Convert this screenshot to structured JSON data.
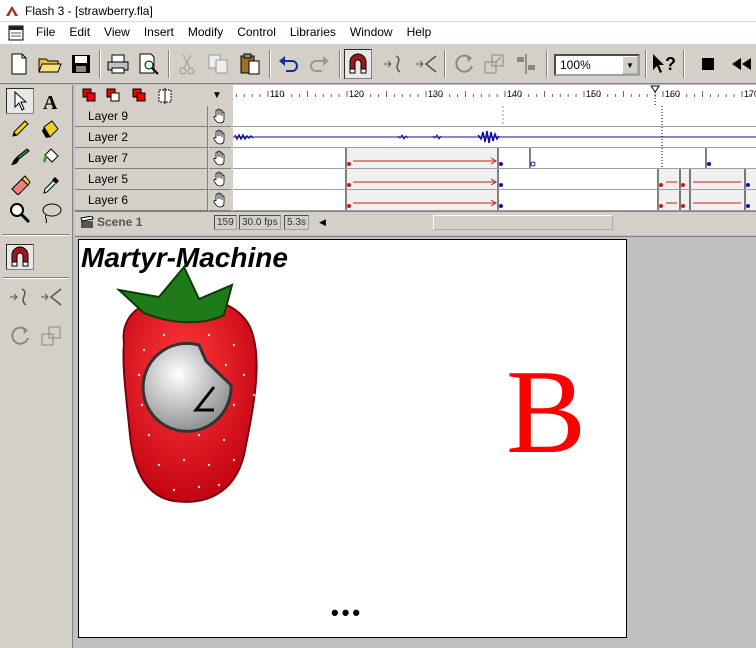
{
  "window": {
    "title": "Flash 3 - [strawberry.fla]"
  },
  "menu": [
    "File",
    "Edit",
    "View",
    "Insert",
    "Modify",
    "Control",
    "Libraries",
    "Window",
    "Help"
  ],
  "toolbar": {
    "zoom": "100%",
    "buttons": [
      "new-file",
      "open",
      "save",
      "print",
      "print-preview",
      "cut",
      "copy",
      "paste",
      "undo",
      "redo",
      "snap",
      "smooth",
      "straighten",
      "rotate",
      "scale",
      "align",
      "help",
      "stop",
      "rewind"
    ]
  },
  "timeline": {
    "ruler": [
      "110",
      "120",
      "130",
      "140",
      "150",
      "160",
      "170"
    ],
    "layers": [
      {
        "name": "Layer 9"
      },
      {
        "name": "Layer 2"
      },
      {
        "name": "Layer 7"
      },
      {
        "name": "Layer 5"
      },
      {
        "name": "Layer 6"
      }
    ],
    "scene": "Scene 1",
    "current_frame": "159",
    "fps": "30.0 fps",
    "time": "5.3s"
  },
  "stage": {
    "title": "Martyr-Machine",
    "letter": "B",
    "dots": "•••"
  },
  "colors": {
    "letter": "#ff0000",
    "strawberry": "#e8101e",
    "leaves": "#1f7a1a",
    "tween": "#d01818",
    "keyframe_blue": "#1010c0"
  }
}
